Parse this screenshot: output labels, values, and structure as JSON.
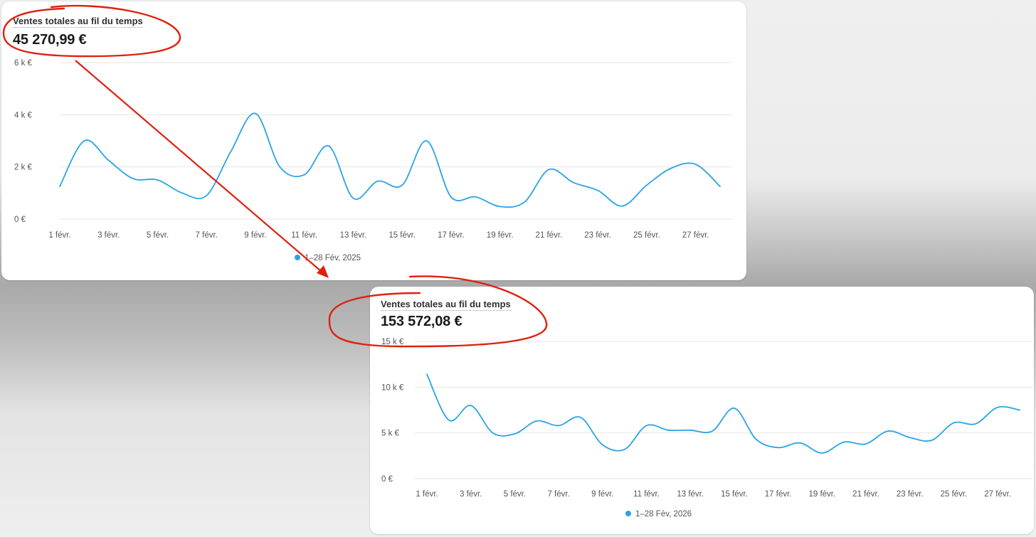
{
  "charts": [
    {
      "title": "Ventes totales au fil du temps",
      "total": "45 270,99 €",
      "legend": "1–28 Fév, 2025",
      "series_color": "#29a3e6"
    },
    {
      "title": "Ventes totales au fil du temps",
      "total": "153 572,08 €",
      "legend": "1–28 Fév, 2026",
      "series_color": "#29a3e6"
    }
  ],
  "annotation_color": "#e0200f",
  "chart_data": [
    {
      "type": "line",
      "title": "Ventes totales au fil du temps",
      "xlabel": "",
      "ylabel": "",
      "ylim": [
        0,
        6000
      ],
      "y_ticks": [
        "0 €",
        "2 k €",
        "4 k €",
        "6 k €"
      ],
      "y_tick_values": [
        0,
        2000,
        4000,
        6000
      ],
      "x_tick_labels": [
        "1 févr.",
        "3 févr.",
        "5 févr.",
        "7 févr.",
        "9 févr.",
        "11 févr.",
        "13 févr.",
        "15 févr.",
        "17 févr.",
        "19 févr.",
        "21 févr.",
        "23 févr.",
        "25 févr.",
        "27 févr."
      ],
      "grid": true,
      "legend_position": "bottom-center",
      "series": [
        {
          "name": "1–28 Fév, 2025",
          "x": [
            "1 févr.",
            "2 févr.",
            "3 févr.",
            "4 févr.",
            "5 févr.",
            "6 févr.",
            "7 févr.",
            "8 févr.",
            "9 févr.",
            "10 févr.",
            "11 févr.",
            "12 févr.",
            "13 févr.",
            "14 févr.",
            "15 févr.",
            "16 févr.",
            "17 févr.",
            "18 févr.",
            "19 févr.",
            "20 févr.",
            "21 févr.",
            "22 févr.",
            "23 févr.",
            "24 févr.",
            "25 févr.",
            "26 févr.",
            "27 févr.",
            "28 févr."
          ],
          "values": [
            1250,
            3000,
            2250,
            1550,
            1500,
            1000,
            900,
            2600,
            4050,
            2000,
            1700,
            2800,
            800,
            1450,
            1300,
            3000,
            850,
            850,
            480,
            650,
            1900,
            1400,
            1100,
            500,
            1300,
            1950,
            2100,
            1250
          ]
        }
      ]
    },
    {
      "type": "line",
      "title": "Ventes totales au fil du temps",
      "xlabel": "",
      "ylabel": "",
      "ylim": [
        0,
        15000
      ],
      "y_ticks": [
        "0 €",
        "5 k €",
        "10 k €",
        "15 k €"
      ],
      "y_tick_values": [
        0,
        5000,
        10000,
        15000
      ],
      "x_tick_labels": [
        "1 févr.",
        "3 févr.",
        "5 févr.",
        "7 févr.",
        "9 févr.",
        "11 févr.",
        "13 févr.",
        "15 févr.",
        "17 févr.",
        "19 févr.",
        "21 févr.",
        "23 févr.",
        "25 févr.",
        "27 févr."
      ],
      "grid": true,
      "legend_position": "bottom-center",
      "series": [
        {
          "name": "1–28 Fév, 2026",
          "x": [
            "1 févr.",
            "2 févr.",
            "3 févr.",
            "4 févr.",
            "5 févr.",
            "6 févr.",
            "7 févr.",
            "8 févr.",
            "9 févr.",
            "10 févr.",
            "11 févr.",
            "12 févr.",
            "13 févr.",
            "14 févr.",
            "15 févr.",
            "16 févr.",
            "17 févr.",
            "18 févr.",
            "19 févr.",
            "20 févr.",
            "21 févr.",
            "22 févr.",
            "23 févr.",
            "24 févr.",
            "25 févr.",
            "26 févr.",
            "27 févr.",
            "28 févr."
          ],
          "values": [
            11400,
            6400,
            8000,
            5000,
            4900,
            6300,
            5800,
            6700,
            3700,
            3200,
            5800,
            5300,
            5300,
            5200,
            7700,
            4300,
            3400,
            3900,
            2800,
            4000,
            3800,
            5200,
            4500,
            4200,
            6100,
            6000,
            7800,
            7500
          ]
        }
      ]
    }
  ]
}
